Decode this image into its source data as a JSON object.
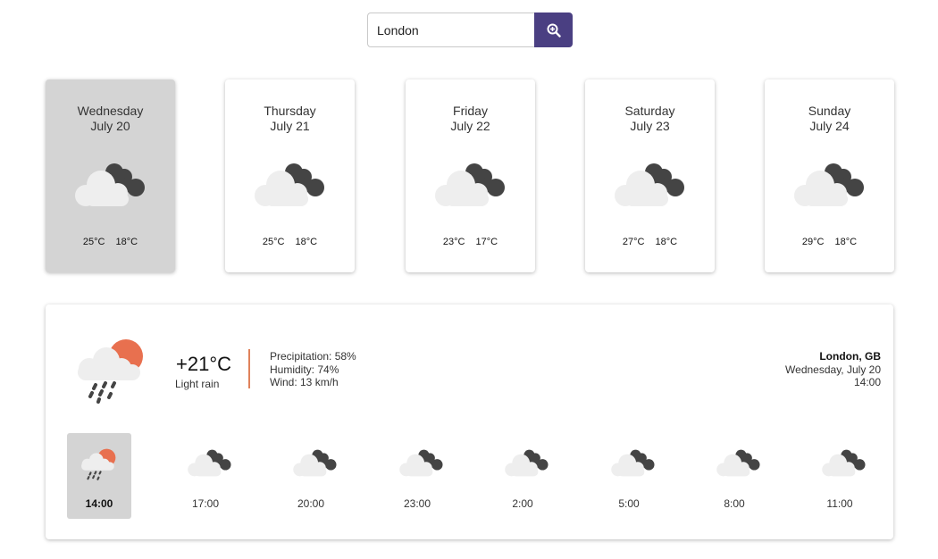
{
  "search": {
    "value": "London",
    "button_icon": "zoom-search-icon"
  },
  "colors": {
    "accent": "#4a3f82",
    "sun": "#e8704f",
    "cloud_dark": "#444444",
    "cloud_light": "#eeeeee",
    "active_bg": "#d4d4d4"
  },
  "forecast": [
    {
      "day": "Wednesday",
      "date": "July 20",
      "high": "25°C",
      "low": "18°C",
      "icon": "cloudy-icon",
      "active": true
    },
    {
      "day": "Thursday",
      "date": "July 21",
      "high": "25°C",
      "low": "18°C",
      "icon": "cloudy-icon",
      "active": false
    },
    {
      "day": "Friday",
      "date": "July 22",
      "high": "23°C",
      "low": "17°C",
      "icon": "cloudy-icon",
      "active": false
    },
    {
      "day": "Saturday",
      "date": "July 23",
      "high": "27°C",
      "low": "18°C",
      "icon": "cloudy-icon",
      "active": false
    },
    {
      "day": "Sunday",
      "date": "July 24",
      "high": "29°C",
      "low": "18°C",
      "icon": "cloudy-icon",
      "active": false
    }
  ],
  "current": {
    "temp": "+21°C",
    "description": "Light rain",
    "precipitation": "Precipitation: 58%",
    "humidity": "Humidity: 74%",
    "wind": "Wind: 13 km/h",
    "city": "London, GB",
    "date": "Wednesday, July 20",
    "time": "14:00",
    "icon": "light-rain-icon"
  },
  "hourly": [
    {
      "time": "14:00",
      "icon": "light-rain-icon",
      "active": true
    },
    {
      "time": "17:00",
      "icon": "cloudy-icon",
      "active": false
    },
    {
      "time": "20:00",
      "icon": "cloudy-icon",
      "active": false
    },
    {
      "time": "23:00",
      "icon": "cloudy-icon",
      "active": false
    },
    {
      "time": "2:00",
      "icon": "cloudy-icon",
      "active": false
    },
    {
      "time": "5:00",
      "icon": "cloudy-icon",
      "active": false
    },
    {
      "time": "8:00",
      "icon": "cloudy-icon",
      "active": false
    },
    {
      "time": "11:00",
      "icon": "cloudy-icon",
      "active": false
    }
  ]
}
